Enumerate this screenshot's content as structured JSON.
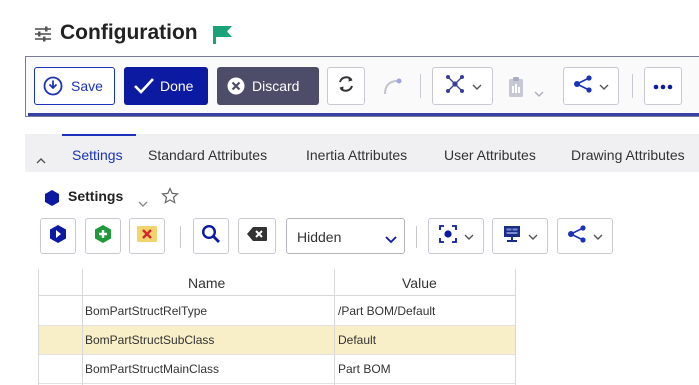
{
  "header": {
    "title": "Configuration"
  },
  "toolbar": {
    "save_label": "Save",
    "done_label": "Done",
    "discard_label": "Discard"
  },
  "tabs": [
    {
      "label": "Settings"
    },
    {
      "label": "Standard Attributes"
    },
    {
      "label": "Inertia Attributes"
    },
    {
      "label": "User Attributes"
    },
    {
      "label": "Drawing Attributes"
    }
  ],
  "section": {
    "title": "Settings"
  },
  "filter": {
    "selected": "Hidden"
  },
  "grid": {
    "columns": [
      "Name",
      "Value"
    ],
    "rows": [
      {
        "name": "BomPartStructRelType",
        "value": "/Part BOM/Default"
      },
      {
        "name": "BomPartStructSubClass",
        "value": "Default"
      },
      {
        "name": "BomPartStructMainClass",
        "value": "Part BOM"
      }
    ]
  },
  "colors": {
    "accent": "#1a33b8",
    "done_bg": "#0b1aa0",
    "discard_bg": "#4d4d6a",
    "selected_row": "#f8eec7",
    "flag": "#1aa37a"
  }
}
